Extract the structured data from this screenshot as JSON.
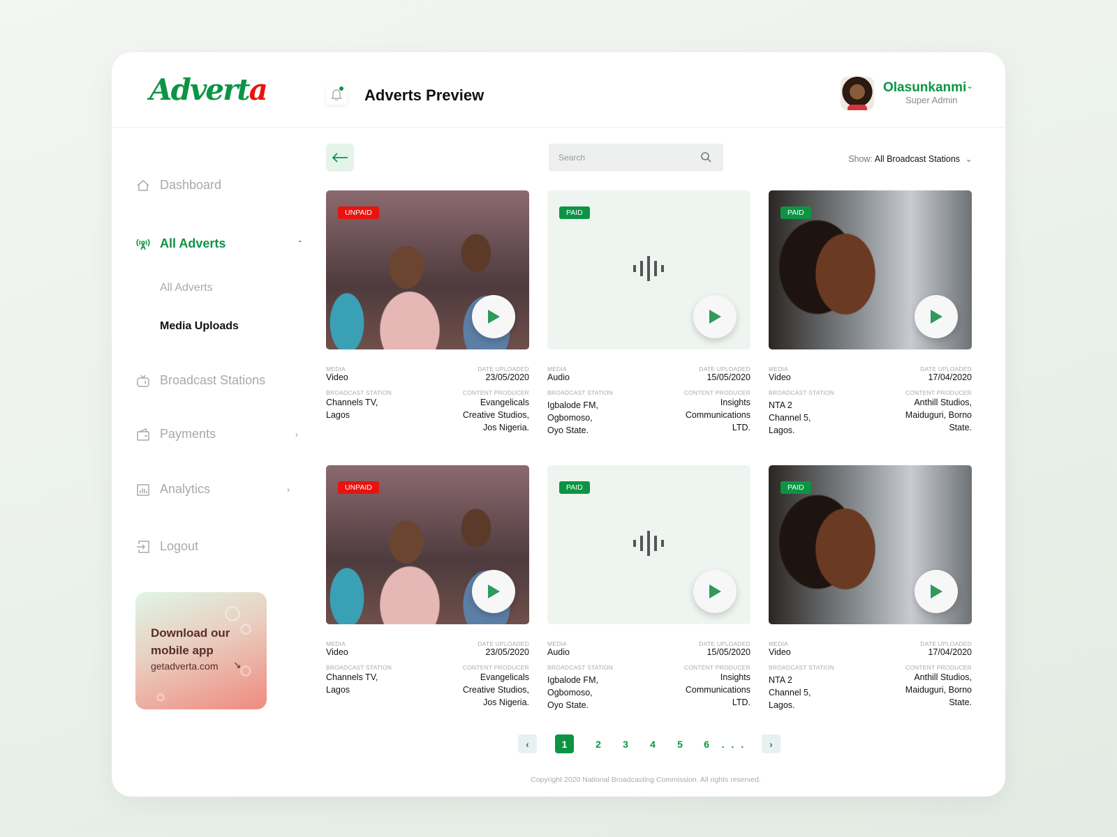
{
  "brand": {
    "logo_main": "Advert",
    "logo_accent": "a",
    "green": "#0c9444",
    "red": "#e8130f"
  },
  "header": {
    "title": "Adverts Preview",
    "user_name": "Olasunkanmi",
    "user_role": "Super Admin"
  },
  "sidebar": {
    "items": [
      {
        "label": "Dashboard",
        "icon": "home-icon"
      },
      {
        "label": "All Adverts",
        "icon": "broadcast-antenna-icon",
        "active": true,
        "expanded": true
      },
      {
        "label": "Broadcast Stations",
        "icon": "tv-icon"
      },
      {
        "label": "Payments",
        "icon": "wallet-icon"
      },
      {
        "label": "Analytics",
        "icon": "bar-chart-icon"
      },
      {
        "label": "Logout",
        "icon": "logout-icon"
      }
    ],
    "subitems": [
      {
        "label": "All Adverts"
      },
      {
        "label": "Media Uploads",
        "active": true
      }
    ],
    "promo": {
      "title": "Download our mobile app",
      "link": "getadverta.com"
    }
  },
  "toolbar": {
    "search_placeholder": "Search",
    "show_label": "Show:",
    "show_value": "All Broadcast Stations"
  },
  "labels": {
    "media": "MEDIA",
    "date": "DATE UPLOADED",
    "station": "BROADCAST STATION",
    "producer": "CONTENT PRODUCER"
  },
  "adverts": [
    {
      "status": "UNPAID",
      "media": "Video",
      "date": "23/05/2020",
      "station": [
        "Channels TV,",
        "Lagos"
      ],
      "producer": [
        "Evangelicals",
        "Creative Studios,",
        "Jos Nigeria."
      ]
    },
    {
      "status": "PAID",
      "media": "Audio",
      "date": "15/05/2020",
      "station": [
        "Igbalode FM,",
        "Ogbomoso,",
        "Oyo State."
      ],
      "producer": [
        "Insights",
        "Communications",
        "LTD."
      ]
    },
    {
      "status": "PAID",
      "media": "Video",
      "date": "17/04/2020",
      "station": [
        "NTA 2",
        "Channel 5,",
        "Lagos."
      ],
      "producer": [
        "Anthill Studios,",
        "Maiduguri, Borno",
        "State."
      ]
    },
    {
      "status": "UNPAID",
      "media": "Video",
      "date": "23/05/2020",
      "station": [
        "Channels TV,",
        "Lagos"
      ],
      "producer": [
        "Evangelicals",
        "Creative Studios,",
        "Jos Nigeria."
      ]
    },
    {
      "status": "PAID",
      "media": "Audio",
      "date": "15/05/2020",
      "station": [
        "Igbalode FM,",
        "Ogbomoso,",
        "Oyo State."
      ],
      "producer": [
        "Insights",
        "Communications",
        "LTD."
      ]
    },
    {
      "status": "PAID",
      "media": "Video",
      "date": "17/04/2020",
      "station": [
        "NTA 2",
        "Channel 5,",
        "Lagos."
      ],
      "producer": [
        "Anthill Studios,",
        "Maiduguri, Borno",
        "State."
      ]
    }
  ],
  "pagination": {
    "pages": [
      "1",
      "2",
      "3",
      "4",
      "5",
      "6"
    ],
    "current": "1",
    "ellipsis": ". . ."
  },
  "footer": {
    "copyright": "Copyright 2020 National Broadcasting Commission. All rights reserved."
  }
}
